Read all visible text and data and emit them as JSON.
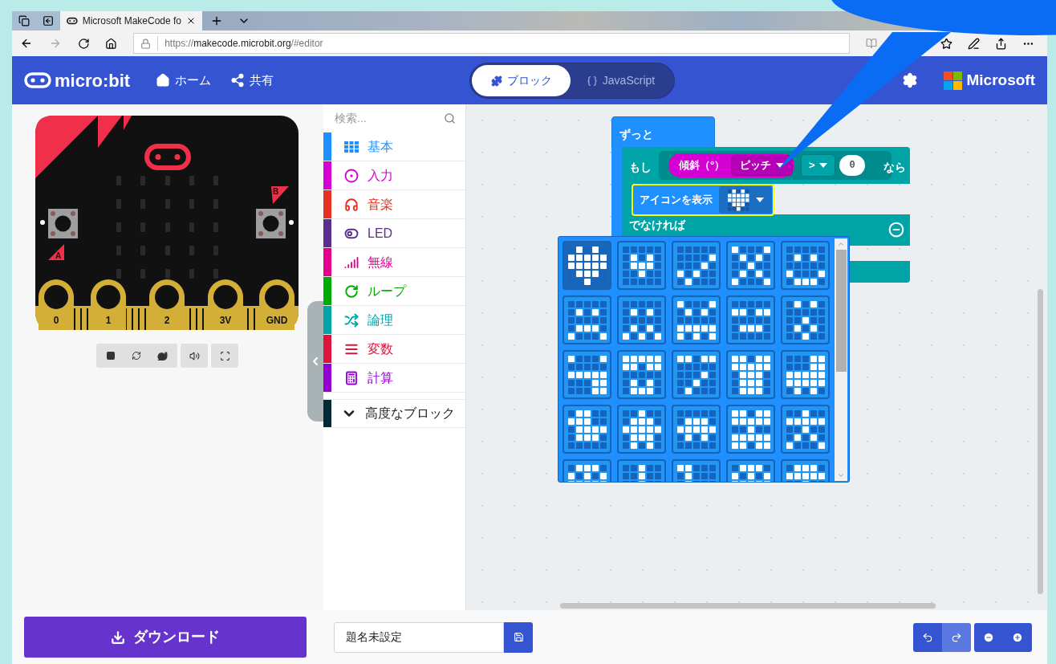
{
  "browser": {
    "tab_title": "Microsoft MakeCode fo",
    "url_prefix": "https://",
    "url_host": "makecode.microbit.org",
    "url_suffix": "/#editor"
  },
  "header": {
    "logo": "micro:bit",
    "nav": [
      {
        "label": "ホーム",
        "kind": "home"
      },
      {
        "label": "共有",
        "kind": "share"
      }
    ],
    "editor_tabs": [
      {
        "label": "ブロック",
        "kind": "blocks",
        "selected": true
      },
      {
        "label": "JavaScript",
        "kind": "javascript",
        "selected": false
      }
    ],
    "brand": "Microsoft"
  },
  "simulator": {
    "pins": [
      "0",
      "1",
      "2",
      "3V",
      "GND"
    ],
    "buttons": [
      "A",
      "B"
    ]
  },
  "toolbox": {
    "search": {
      "placeholder": "検索..."
    },
    "categories": [
      {
        "label": "基本",
        "kind": "basic",
        "color": "#1e90ff"
      },
      {
        "label": "入力",
        "kind": "input",
        "color": "#d400d4"
      },
      {
        "label": "音楽",
        "kind": "music",
        "color": "#e63022"
      },
      {
        "label": "LED",
        "kind": "led",
        "color": "#5c2d91"
      },
      {
        "label": "無線",
        "kind": "radio",
        "color": "#e3008c"
      },
      {
        "label": "ループ",
        "kind": "loops",
        "color": "#00aa00"
      },
      {
        "label": "論理",
        "kind": "logic",
        "color": "#00a4a6"
      },
      {
        "label": "変数",
        "kind": "variables",
        "color": "#dc143c"
      },
      {
        "label": "計算",
        "kind": "math",
        "color": "#9400d3"
      }
    ],
    "advanced": {
      "label": "高度なブロック",
      "color": "#002b36"
    }
  },
  "workspace": {
    "forever": "ずっと",
    "if": "もし",
    "tilt": "傾斜（°）",
    "axis": "ピッチ",
    "operator": ">",
    "value": "0",
    "then": "なら",
    "show_icon": "アイコンを表示",
    "else": "でなければ",
    "icon_picker": {
      "icons": [
        {
          "selected": true
        },
        {
          "selected": false
        },
        {
          "selected": false
        },
        {
          "selected": false
        },
        {
          "selected": false
        },
        {
          "selected": false
        },
        {
          "selected": false
        },
        {
          "selected": false
        },
        {
          "selected": false
        },
        {
          "selected": false
        },
        {
          "selected": false
        },
        {
          "selected": false
        },
        {
          "selected": false
        },
        {
          "selected": false
        },
        {
          "selected": false
        },
        {
          "selected": false
        },
        {
          "selected": false
        },
        {
          "selected": false
        },
        {
          "selected": false
        },
        {
          "selected": false
        },
        {
          "selected": false
        },
        {
          "selected": false
        },
        {
          "selected": false
        },
        {
          "selected": false
        },
        {
          "selected": false
        }
      ]
    }
  },
  "footer": {
    "download": "ダウンロード",
    "project_name": "題名未設定"
  }
}
